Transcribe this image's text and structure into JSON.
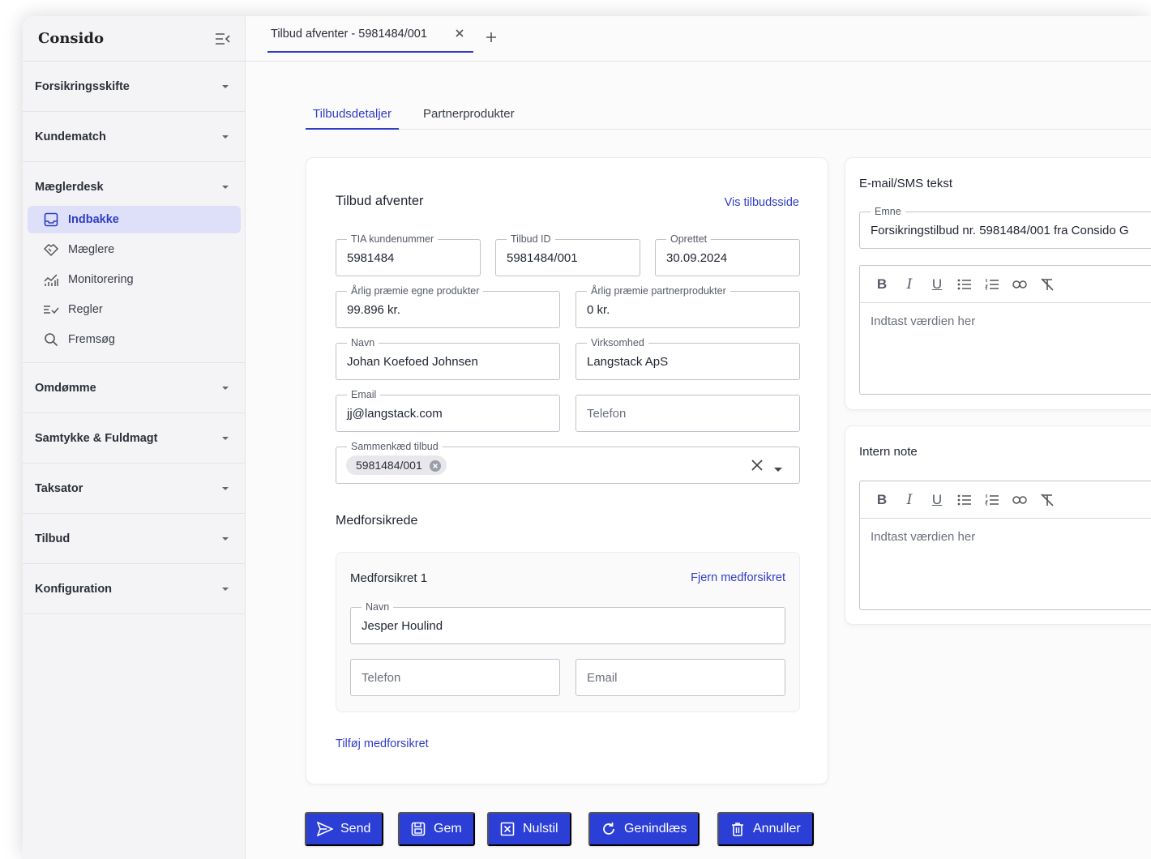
{
  "app": {
    "brand": "Consido"
  },
  "sidebar": {
    "sections": [
      {
        "label": "Forsikringsskifte"
      },
      {
        "label": "Kundematch"
      },
      {
        "label": "Mæglerdesk"
      },
      {
        "label": "Omdømme"
      },
      {
        "label": "Samtykke & Fuldmagt"
      },
      {
        "label": "Taksator"
      },
      {
        "label": "Tilbud"
      },
      {
        "label": "Konfiguration"
      }
    ],
    "maeglerdesk_items": [
      {
        "label": "Indbakke",
        "icon": "inbox-icon",
        "active": true
      },
      {
        "label": "Mæglere",
        "icon": "handshake-icon"
      },
      {
        "label": "Monitorering",
        "icon": "chart-icon"
      },
      {
        "label": "Regler",
        "icon": "rules-icon"
      },
      {
        "label": "Fremsøg",
        "icon": "search-icon"
      }
    ]
  },
  "tabs": {
    "open_tab": "Tilbud afventer - 5981484/001"
  },
  "subtabs": [
    "Tilbudsdetaljer",
    "Partnerprodukter"
  ],
  "offer": {
    "title": "Tilbud afventer",
    "view_link": "Vis tilbudsside",
    "fields": {
      "tia_label": "TIA kundenummer",
      "tia_value": "5981484",
      "offer_id_label": "Tilbud ID",
      "offer_id_value": "5981484/001",
      "created_label": "Oprettet",
      "created_value": "30.09.2024",
      "own_premium_label": "Årlig præmie egne produkter",
      "own_premium_value": "99.896 kr.",
      "partner_premium_label": "Årlig præmie partnerprodukter",
      "partner_premium_value": "0 kr.",
      "name_label": "Navn",
      "name_value": "Johan Koefoed Johnsen",
      "company_label": "Virksomhed",
      "company_value": "Langstack ApS",
      "email_label": "Email",
      "email_value": "jj@langstack.com",
      "phone_placeholder": "Telefon",
      "linked_label": "Sammenkæd tilbud",
      "linked_chip": "5981484/001"
    },
    "coinsured": {
      "heading": "Medforsikrede",
      "card_title": "Medforsikret 1",
      "remove_link": "Fjern medforsikret",
      "name_label": "Navn",
      "name_value": "Jesper Houlind",
      "phone_placeholder": "Telefon",
      "email_placeholder": "Email",
      "add_link": "Tilføj medforsikret"
    }
  },
  "email_card": {
    "title": "E-mail/SMS tekst",
    "subject_label": "Emne",
    "subject_value": "Forsikringstilbud nr. 5981484/001 fra Consido G",
    "editor_placeholder": "Indtast værdien her"
  },
  "note_card": {
    "title": "Intern note",
    "editor_placeholder": "Indtast værdien her"
  },
  "actions": {
    "send": "Send",
    "save": "Gem",
    "reset": "Nulstil",
    "reload": "Genindlæs",
    "cancel": "Annuller"
  },
  "colors": {
    "accent": "#2b3fd6",
    "active_bg": "#dde0f8"
  }
}
